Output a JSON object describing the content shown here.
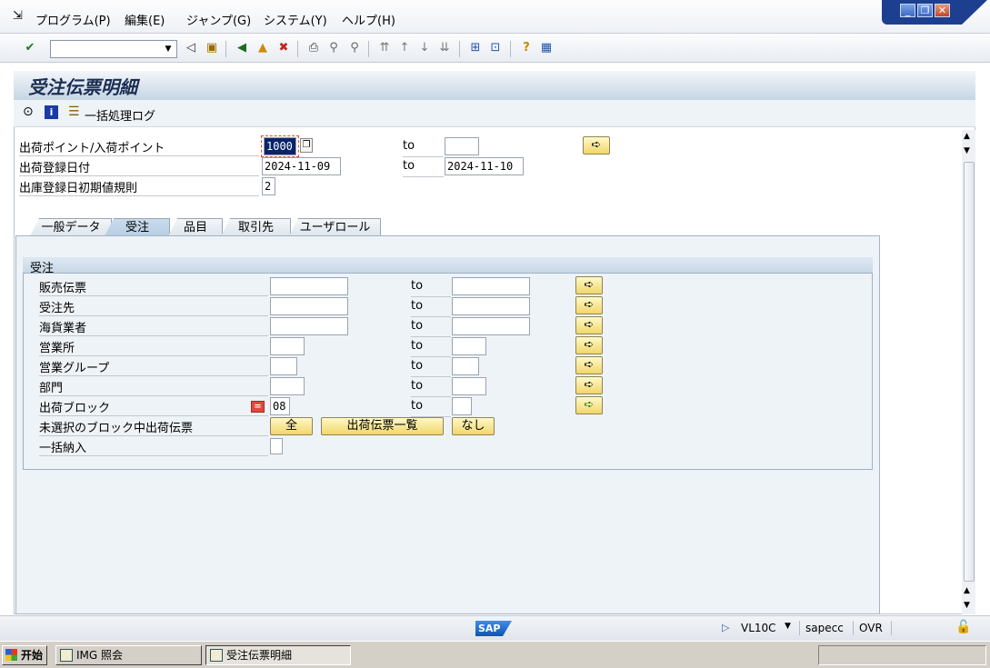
{
  "menu": [
    "プログラム(P)",
    "編集(E)",
    "ジャンプ(G)",
    "システム(Y)",
    "ヘルプ(H)"
  ],
  "window_controls": {
    "minimize": "_",
    "restore": "❐",
    "close": "✕"
  },
  "screen_title": "受注伝票明細",
  "app_toolbar": {
    "batch_log_label": "一括処理ログ"
  },
  "header_fields": {
    "to_label": "to",
    "shipping_point": {
      "label": "出荷ポイント/入荷ポイント",
      "value": "1000",
      "to_value": ""
    },
    "delivery_creation_date": {
      "label": "出荷登録日付",
      "value": "2024-11-09",
      "to_value": "2024-11-10"
    },
    "default_rule": {
      "label": "出庫登録日初期値規則",
      "value": "2"
    }
  },
  "tabs": [
    {
      "label": "一般データ",
      "active": false
    },
    {
      "label": "受注",
      "active": true
    },
    {
      "label": "品目",
      "active": false
    },
    {
      "label": "取引先",
      "active": false
    },
    {
      "label": "ユーザロール",
      "active": false
    }
  ],
  "group": {
    "title": "受注",
    "to_label": "to",
    "rows": [
      {
        "label": "販売伝票",
        "from": "",
        "to": ""
      },
      {
        "label": "受注先",
        "from": "",
        "to": ""
      },
      {
        "label": "海貨業者",
        "from": "",
        "to": ""
      },
      {
        "label": "営業所",
        "from": "",
        "to": ""
      },
      {
        "label": "営業グループ",
        "from": "",
        "to": ""
      },
      {
        "label": "部門",
        "from": "",
        "to": ""
      },
      {
        "label": "出荷ブロック",
        "from": "08",
        "to": ""
      }
    ],
    "unselected_block": {
      "label": "未選択のブロック中出荷伝票",
      "btn_all": "全",
      "btn_list": "出荷伝票一覧",
      "btn_none": "なし"
    },
    "collective": {
      "label": "一括納入"
    }
  },
  "status_bar": {
    "logo": "SAP",
    "transaction": "VL10C",
    "server": "sapecc",
    "mode": "OVR"
  },
  "taskbar": {
    "start": "开始",
    "task1": "IMG 照会",
    "task2": "受注伝票明細"
  },
  "colors": {
    "frame_header": "#c6d6e4",
    "button_yellow": "#f2d66a",
    "taskbar": "#d4d0c8"
  }
}
